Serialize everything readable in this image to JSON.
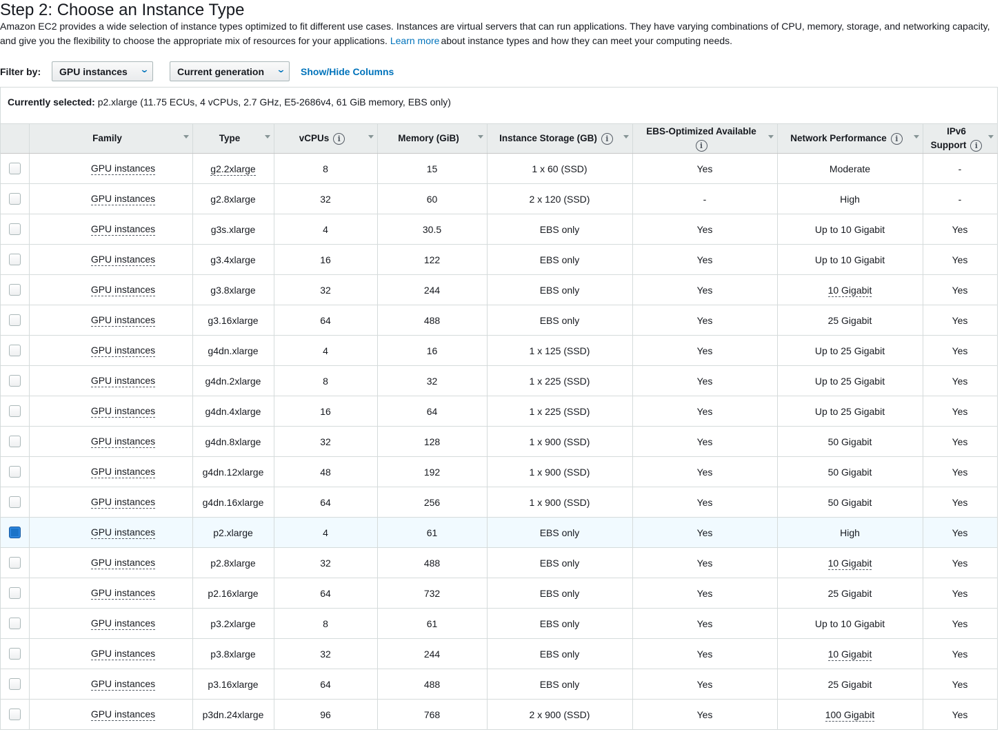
{
  "page": {
    "title": "Step 2: Choose an Instance Type",
    "description_before": "Amazon EC2 provides a wide selection of instance types optimized to fit different use cases. Instances are virtual servers that can run applications. They have varying combinations of CPU, memory, storage, and networking capacity, and give you the flexibility to choose the appropriate mix of resources for your applications.",
    "learn_more": "Learn more",
    "description_after": "about instance types and how they can meet your computing needs."
  },
  "filters": {
    "label": "Filter by:",
    "family_select": "GPU instances",
    "generation_select": "Current generation",
    "show_hide": "Show/Hide Columns"
  },
  "selection": {
    "label": "Currently selected:",
    "value": "p2.xlarge (11.75 ECUs, 4 vCPUs, 2.7 GHz, E5-2686v4, 61 GiB memory, EBS only)"
  },
  "columns": {
    "family": "Family",
    "type": "Type",
    "vcpus": "vCPUs",
    "memory": "Memory (GiB)",
    "storage": "Instance Storage (GB)",
    "ebs": "EBS-Optimized Available",
    "network": "Network Performance",
    "ipv6_line1": "IPv6",
    "ipv6_line2": "Support"
  },
  "icons": {
    "info": "info-icon",
    "sort": "sort-caret-icon",
    "dropdown": "chevron-down-icon"
  },
  "colors": {
    "link": "#0073bb",
    "selected_row": "#f1faff",
    "checkbox_checked": "#1a73c8",
    "header_bg": "#eaeded"
  },
  "rows": [
    {
      "checked": false,
      "family": "GPU instances",
      "type": "g2.2xlarge",
      "vcpus": "8",
      "memory": "15",
      "storage": "1 x 60 (SSD)",
      "ebs": "Yes",
      "network": "Moderate",
      "ipv6": "-",
      "type_dotted": true,
      "net_dotted": false
    },
    {
      "checked": false,
      "family": "GPU instances",
      "type": "g2.8xlarge",
      "vcpus": "32",
      "memory": "60",
      "storage": "2 x 120 (SSD)",
      "ebs": "-",
      "network": "High",
      "ipv6": "-",
      "type_dotted": false,
      "net_dotted": false
    },
    {
      "checked": false,
      "family": "GPU instances",
      "type": "g3s.xlarge",
      "vcpus": "4",
      "memory": "30.5",
      "storage": "EBS only",
      "ebs": "Yes",
      "network": "Up to 10 Gigabit",
      "ipv6": "Yes",
      "type_dotted": false,
      "net_dotted": false
    },
    {
      "checked": false,
      "family": "GPU instances",
      "type": "g3.4xlarge",
      "vcpus": "16",
      "memory": "122",
      "storage": "EBS only",
      "ebs": "Yes",
      "network": "Up to 10 Gigabit",
      "ipv6": "Yes",
      "type_dotted": false,
      "net_dotted": false
    },
    {
      "checked": false,
      "family": "GPU instances",
      "type": "g3.8xlarge",
      "vcpus": "32",
      "memory": "244",
      "storage": "EBS only",
      "ebs": "Yes",
      "network": "10 Gigabit",
      "ipv6": "Yes",
      "type_dotted": false,
      "net_dotted": true
    },
    {
      "checked": false,
      "family": "GPU instances",
      "type": "g3.16xlarge",
      "vcpus": "64",
      "memory": "488",
      "storage": "EBS only",
      "ebs": "Yes",
      "network": "25 Gigabit",
      "ipv6": "Yes",
      "type_dotted": false,
      "net_dotted": false
    },
    {
      "checked": false,
      "family": "GPU instances",
      "type": "g4dn.xlarge",
      "vcpus": "4",
      "memory": "16",
      "storage": "1 x 125 (SSD)",
      "ebs": "Yes",
      "network": "Up to 25 Gigabit",
      "ipv6": "Yes",
      "type_dotted": false,
      "net_dotted": false
    },
    {
      "checked": false,
      "family": "GPU instances",
      "type": "g4dn.2xlarge",
      "vcpus": "8",
      "memory": "32",
      "storage": "1 x 225 (SSD)",
      "ebs": "Yes",
      "network": "Up to 25 Gigabit",
      "ipv6": "Yes",
      "type_dotted": false,
      "net_dotted": false
    },
    {
      "checked": false,
      "family": "GPU instances",
      "type": "g4dn.4xlarge",
      "vcpus": "16",
      "memory": "64",
      "storage": "1 x 225 (SSD)",
      "ebs": "Yes",
      "network": "Up to 25 Gigabit",
      "ipv6": "Yes",
      "type_dotted": false,
      "net_dotted": false
    },
    {
      "checked": false,
      "family": "GPU instances",
      "type": "g4dn.8xlarge",
      "vcpus": "32",
      "memory": "128",
      "storage": "1 x 900 (SSD)",
      "ebs": "Yes",
      "network": "50 Gigabit",
      "ipv6": "Yes",
      "type_dotted": false,
      "net_dotted": false
    },
    {
      "checked": false,
      "family": "GPU instances",
      "type": "g4dn.12xlarge",
      "vcpus": "48",
      "memory": "192",
      "storage": "1 x 900 (SSD)",
      "ebs": "Yes",
      "network": "50 Gigabit",
      "ipv6": "Yes",
      "type_dotted": false,
      "net_dotted": false
    },
    {
      "checked": false,
      "family": "GPU instances",
      "type": "g4dn.16xlarge",
      "vcpus": "64",
      "memory": "256",
      "storage": "1 x 900 (SSD)",
      "ebs": "Yes",
      "network": "50 Gigabit",
      "ipv6": "Yes",
      "type_dotted": false,
      "net_dotted": false
    },
    {
      "checked": true,
      "family": "GPU instances",
      "type": "p2.xlarge",
      "vcpus": "4",
      "memory": "61",
      "storage": "EBS only",
      "ebs": "Yes",
      "network": "High",
      "ipv6": "Yes",
      "type_dotted": false,
      "net_dotted": false
    },
    {
      "checked": false,
      "family": "GPU instances",
      "type": "p2.8xlarge",
      "vcpus": "32",
      "memory": "488",
      "storage": "EBS only",
      "ebs": "Yes",
      "network": "10 Gigabit",
      "ipv6": "Yes",
      "type_dotted": false,
      "net_dotted": true
    },
    {
      "checked": false,
      "family": "GPU instances",
      "type": "p2.16xlarge",
      "vcpus": "64",
      "memory": "732",
      "storage": "EBS only",
      "ebs": "Yes",
      "network": "25 Gigabit",
      "ipv6": "Yes",
      "type_dotted": false,
      "net_dotted": false
    },
    {
      "checked": false,
      "family": "GPU instances",
      "type": "p3.2xlarge",
      "vcpus": "8",
      "memory": "61",
      "storage": "EBS only",
      "ebs": "Yes",
      "network": "Up to 10 Gigabit",
      "ipv6": "Yes",
      "type_dotted": false,
      "net_dotted": false
    },
    {
      "checked": false,
      "family": "GPU instances",
      "type": "p3.8xlarge",
      "vcpus": "32",
      "memory": "244",
      "storage": "EBS only",
      "ebs": "Yes",
      "network": "10 Gigabit",
      "ipv6": "Yes",
      "type_dotted": false,
      "net_dotted": true
    },
    {
      "checked": false,
      "family": "GPU instances",
      "type": "p3.16xlarge",
      "vcpus": "64",
      "memory": "488",
      "storage": "EBS only",
      "ebs": "Yes",
      "network": "25 Gigabit",
      "ipv6": "Yes",
      "type_dotted": false,
      "net_dotted": false
    },
    {
      "checked": false,
      "family": "GPU instances",
      "type": "p3dn.24xlarge",
      "vcpus": "96",
      "memory": "768",
      "storage": "2 x 900 (SSD)",
      "ebs": "Yes",
      "network": "100 Gigabit",
      "ipv6": "Yes",
      "type_dotted": false,
      "net_dotted": true
    }
  ]
}
